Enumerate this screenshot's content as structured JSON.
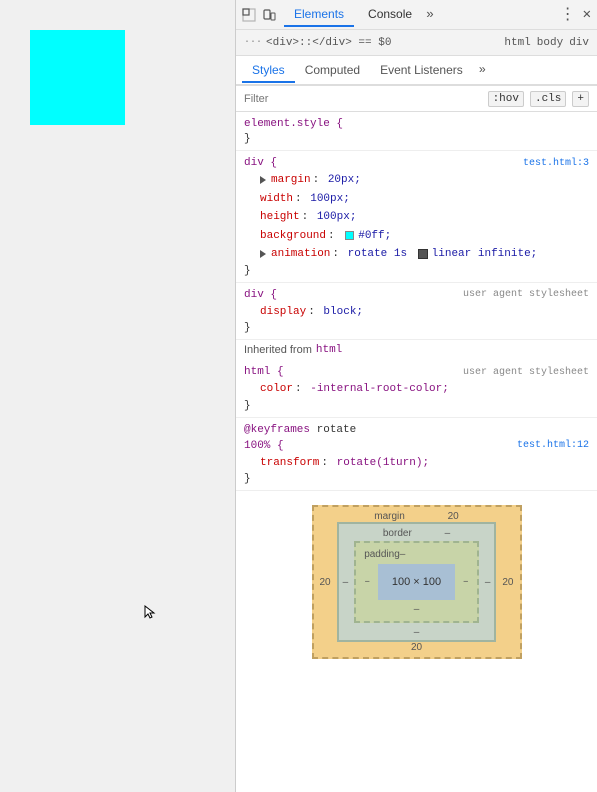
{
  "page": {
    "cyan_box_color": "#00ffff"
  },
  "devtools": {
    "topbar": {
      "tabs": [
        {
          "label": "Elements",
          "active": true
        },
        {
          "label": "Console",
          "active": false
        }
      ],
      "more_label": "»",
      "kebab_label": "⋮",
      "close_label": "✕"
    },
    "breadcrumb": {
      "items": [
        "html",
        "body",
        "div"
      ]
    },
    "subtabs": [
      {
        "label": "Styles",
        "active": true
      },
      {
        "label": "Computed",
        "active": false
      },
      {
        "label": "Event Listeners",
        "active": false
      }
    ],
    "filter": {
      "placeholder": "Filter",
      "hov_label": ":hov",
      "cls_label": ".cls",
      "plus_label": "+"
    },
    "styles": {
      "element_style": {
        "selector": "element.style {",
        "close": "}"
      },
      "div_section": {
        "selector": "div {",
        "source": "test.html:3",
        "properties": [
          {
            "name": "margin",
            "colon": ":",
            "value": "▶ 20px;",
            "has_triangle": true
          },
          {
            "name": "width",
            "colon": ":",
            "value": "100px;"
          },
          {
            "name": "height",
            "colon": ":",
            "value": "100px;"
          },
          {
            "name": "background",
            "colon": ":",
            "swatch_color": "#00ffff",
            "value": "#0ff;"
          },
          {
            "name": "animation",
            "colon": ":",
            "value": "▶ rotate 1s",
            "checkbox": true,
            "value2": "linear infinite;"
          }
        ],
        "close": "}"
      },
      "div_ua_section": {
        "selector": "div {",
        "source_label": "user agent stylesheet",
        "properties": [
          {
            "name": "display",
            "colon": ":",
            "value": "block;"
          }
        ],
        "close": "}"
      },
      "inherited": {
        "label": "Inherited from",
        "tag": "html"
      },
      "html_ua_section": {
        "selector": "html {",
        "source_label": "user agent stylesheet",
        "properties": [
          {
            "name": "color",
            "colon": ":",
            "value": "-internal-root-color;"
          }
        ],
        "close": "}"
      },
      "keyframes": {
        "at_rule": "@keyframes",
        "name": "rotate",
        "percent_selector": "100% {",
        "source": "test.html:12",
        "properties": [
          {
            "name": "transform",
            "colon": ":",
            "value": "rotate(1turn);"
          }
        ],
        "close": "}"
      }
    },
    "box_model": {
      "margin_label": "margin",
      "margin_value": "20",
      "border_label": "border",
      "border_value": "–",
      "padding_label": "padding–",
      "content_label": "100 × 100",
      "left_value": "20",
      "right_value": "20",
      "bottom_value": "–",
      "bottom_margin": "20"
    }
  }
}
